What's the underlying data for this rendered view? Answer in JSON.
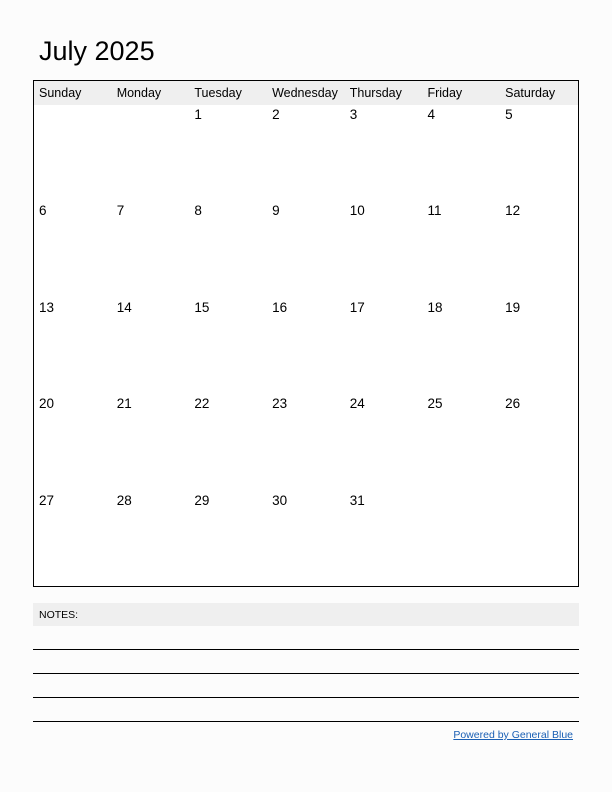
{
  "title": "July 2025",
  "weekdays": [
    "Sunday",
    "Monday",
    "Tuesday",
    "Wednesday",
    "Thursday",
    "Friday",
    "Saturday"
  ],
  "weeks": [
    [
      "",
      "",
      "1",
      "2",
      "3",
      "4",
      "5"
    ],
    [
      "6",
      "7",
      "8",
      "9",
      "10",
      "11",
      "12"
    ],
    [
      "13",
      "14",
      "15",
      "16",
      "17",
      "18",
      "19"
    ],
    [
      "20",
      "21",
      "22",
      "23",
      "24",
      "25",
      "26"
    ],
    [
      "27",
      "28",
      "29",
      "30",
      "31",
      "",
      ""
    ]
  ],
  "notes": {
    "label": "NOTES:",
    "line_count": 4
  },
  "footer": {
    "link_text": "Powered by General Blue",
    "link_color": "#1a5fb4"
  }
}
